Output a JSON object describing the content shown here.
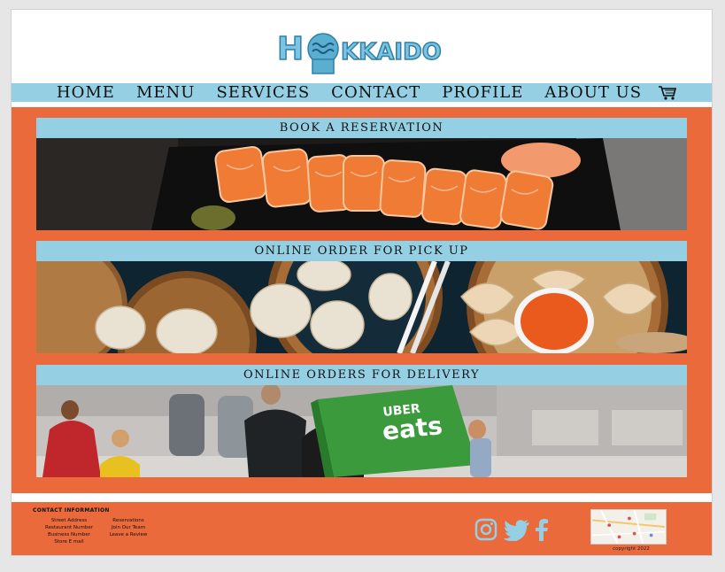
{
  "brand": {
    "name": "HOKKAIDO"
  },
  "nav": {
    "items": [
      "HOME",
      "MENU",
      "SERVICES",
      "CONTACT",
      "PROFILE",
      "ABOUT US"
    ],
    "cart_icon": "cart-icon"
  },
  "cards": [
    {
      "label": "BOOK A RESERVATION",
      "image": "sushi-photo"
    },
    {
      "label": "ONLINE ORDER FOR PICK UP",
      "image": "dumplings-photo"
    },
    {
      "label": "ONLINE ORDERS FOR DELIVERY",
      "image": "delivery-photo"
    }
  ],
  "delivery_bag": {
    "line1": "UBER",
    "line2": "eats"
  },
  "footer": {
    "contact_heading": "CONTACT INFORMATION",
    "col1": [
      "Street Address",
      "Restaurant Number",
      "Business Number",
      "Store E mail"
    ],
    "col2": [
      "Reservations",
      "Join Our Team",
      "Leave a Review"
    ],
    "social": [
      "instagram-icon",
      "twitter-icon",
      "facebook-icon"
    ],
    "copyright": "copyright 2022"
  },
  "colors": {
    "accent_blue": "#94cfe3",
    "brand_orange": "#eb6a3b",
    "logo_blue": "#5aaed0"
  }
}
